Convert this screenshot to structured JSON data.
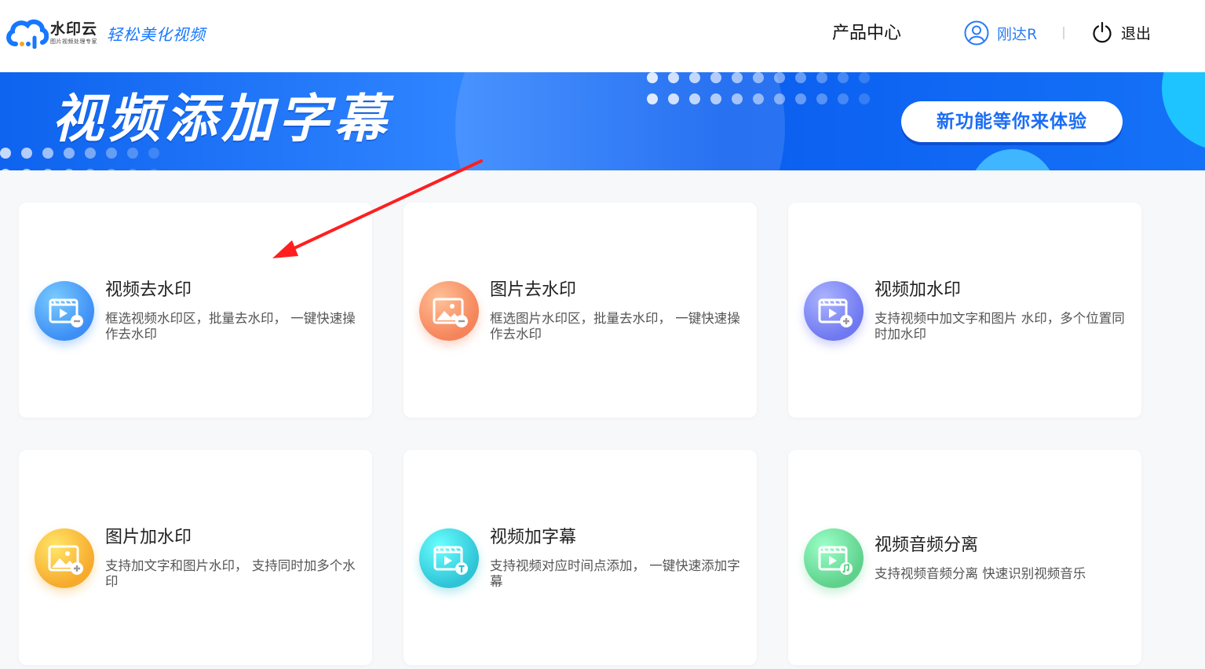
{
  "header": {
    "logo_text": "水印云",
    "logo_sub": "图片视频处理专家",
    "slogan": "轻松美化视频",
    "nav_products": "产品中心",
    "user_name": "刚达R",
    "logout": "退出"
  },
  "banner": {
    "title": "视频添加字幕",
    "button": "新功能等你来体验"
  },
  "cards": [
    {
      "title": "视频去水印",
      "desc": "框选视频水印区，批量去水印，  一键快速操作去水印",
      "icon": "video-remove-watermark-icon",
      "color": "#3d8ff5"
    },
    {
      "title": "图片去水印",
      "desc": "框选图片水印区，批量去水印，  一键快速操作去水印",
      "icon": "image-remove-watermark-icon",
      "color": "#f5845a"
    },
    {
      "title": "视频加水印",
      "desc": "支持视频中加文字和图片 水印，多个位置同时加水印",
      "icon": "video-add-watermark-icon",
      "color": "#6f78f0"
    },
    {
      "title": "图片加水印",
      "desc": "支持加文字和图片水印，  支持同时加多个水印",
      "icon": "image-add-watermark-icon",
      "color": "#f7aa2c"
    },
    {
      "title": "视频加字幕",
      "desc": "支持视频对应时间点添加，  一键快速添加字幕",
      "icon": "video-add-subtitle-icon",
      "color": "#2ec4d6"
    },
    {
      "title": "视频音频分离",
      "desc": "支持视频音频分离 快速识别视频音乐",
      "icon": "video-audio-separate-icon",
      "color": "#5fd18c"
    }
  ],
  "colors": {
    "accent": "#1677ff",
    "banner_blue": "#0e63ef",
    "arrow": "#ff1f1f"
  }
}
